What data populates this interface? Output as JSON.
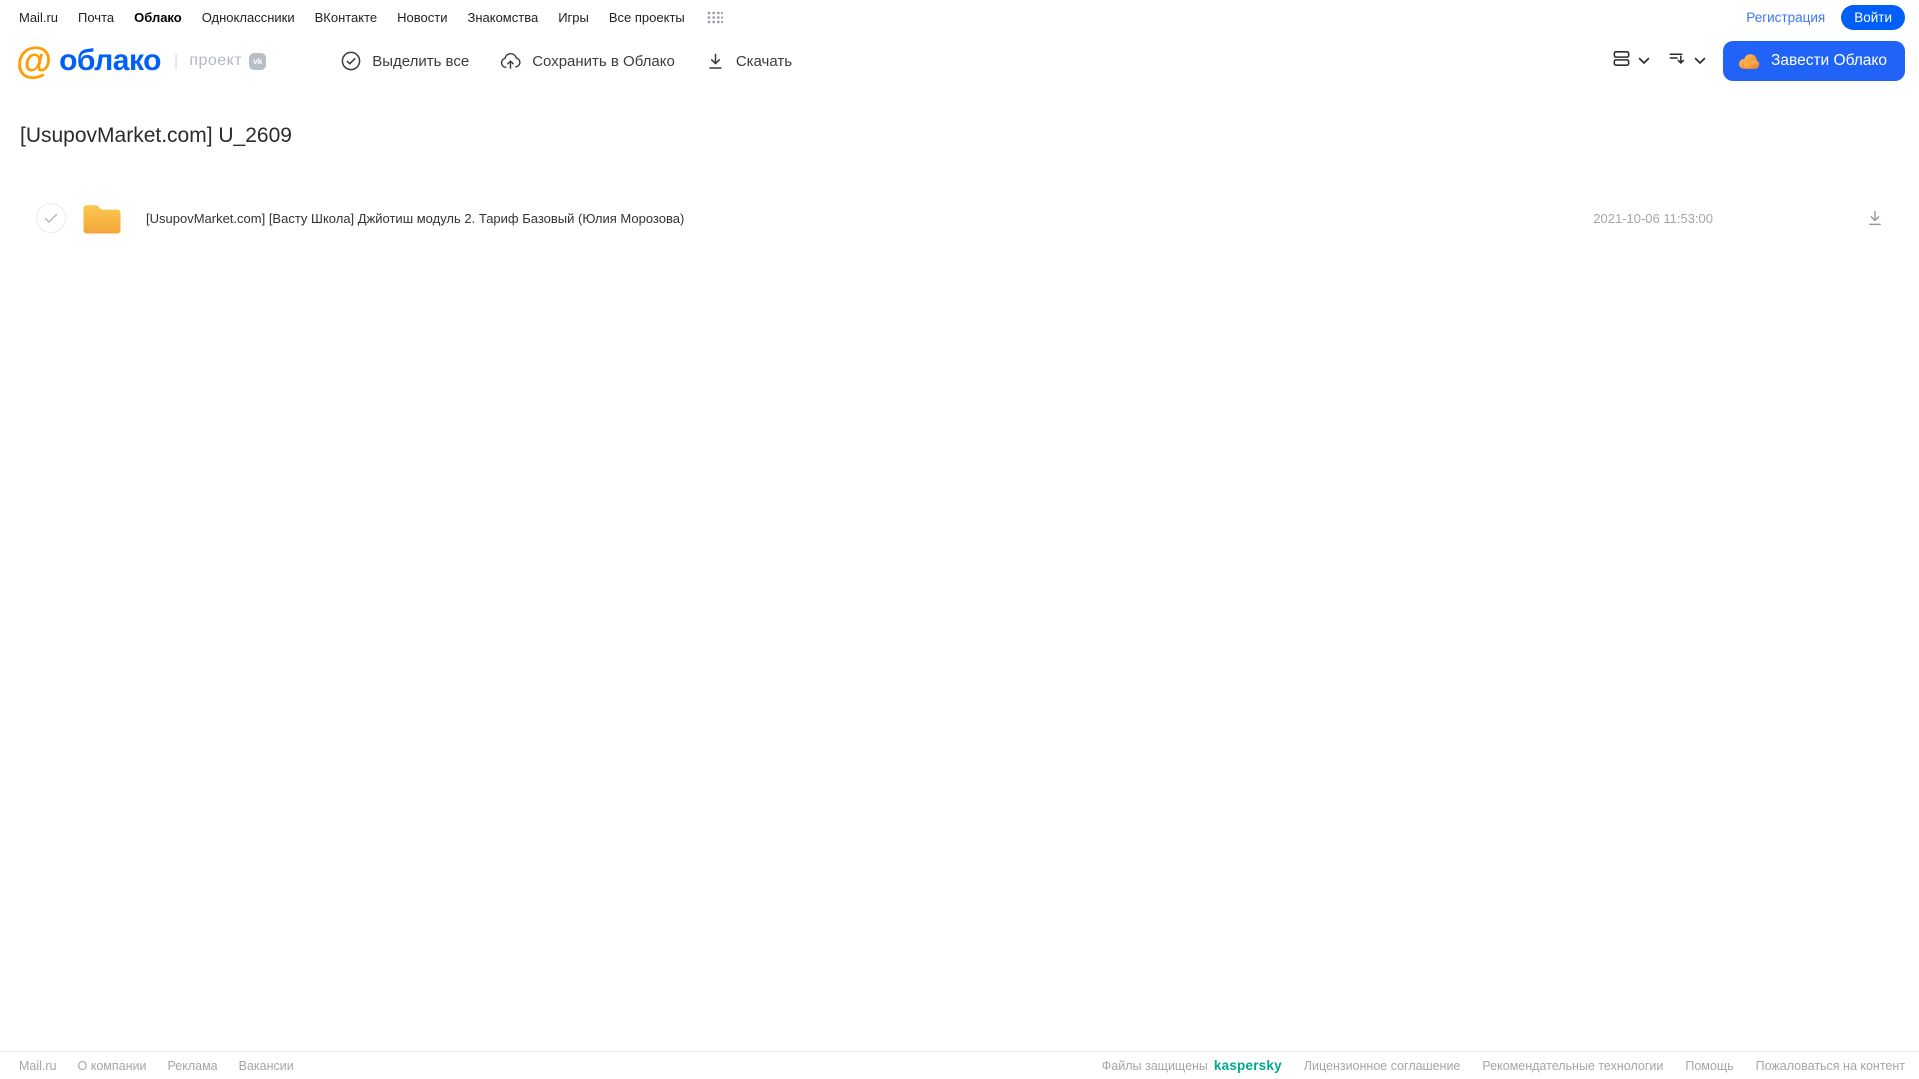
{
  "topnav": {
    "items": [
      {
        "label": "Mail.ru",
        "active": false
      },
      {
        "label": "Почта",
        "active": false
      },
      {
        "label": "Облако",
        "active": true
      },
      {
        "label": "Одноклассники",
        "active": false
      },
      {
        "label": "ВКонтакте",
        "active": false
      },
      {
        "label": "Новости",
        "active": false
      },
      {
        "label": "Знакомства",
        "active": false
      },
      {
        "label": "Игры",
        "active": false
      },
      {
        "label": "Все проекты",
        "active": false
      }
    ],
    "apps_icon": "grid-dots-icon",
    "registration_label": "Регистрация",
    "login_label": "Войти"
  },
  "header": {
    "logo_at": "@",
    "logo_text": "облако",
    "divider": "|",
    "project_label": "проект",
    "vk_badge": "vk",
    "toolbar": {
      "select_all": {
        "label": "Выделить все",
        "icon": "check-circle-icon"
      },
      "save_to_cloud": {
        "label": "Сохранить в Облако",
        "icon": "cloud-upload-icon"
      },
      "download": {
        "label": "Скачать",
        "icon": "download-icon"
      }
    },
    "view_icon": "list-view-icon",
    "sort_icon": "sort-descending-icon",
    "create_cloud_label": "Завести Облако",
    "create_cloud_icon": "cloud-icon"
  },
  "page": {
    "title": "[UsupovMarket.com] U_2609"
  },
  "files": [
    {
      "type": "folder",
      "icon": "folder-icon",
      "name": "[UsupovMarket.com] [Васту Школа] Джйотиш модуль 2. Тариф Базовый  (Юлия Морозова)",
      "date": "2021-10-06 11:53:00",
      "selected": false
    }
  ],
  "footer": {
    "left_links": [
      "Mail.ru",
      "О компании",
      "Реклама",
      "Вакансии"
    ],
    "protected_label": "Файлы защищены",
    "kaspersky_label": "kaspersky",
    "right_links": [
      "Лицензионное соглашение",
      "Рекомендательные технологии",
      "Помощь",
      "Пожаловаться на контент"
    ]
  },
  "colors": {
    "accent_blue": "#005ff9",
    "button_blue": "#2163f6",
    "logo_orange": "#ff9e00",
    "folder_yellow_top": "#fcc851",
    "folder_yellow_bottom": "#f3a63a",
    "kaspersky_green": "#00a88e",
    "muted_gray": "#a6a6a6"
  }
}
